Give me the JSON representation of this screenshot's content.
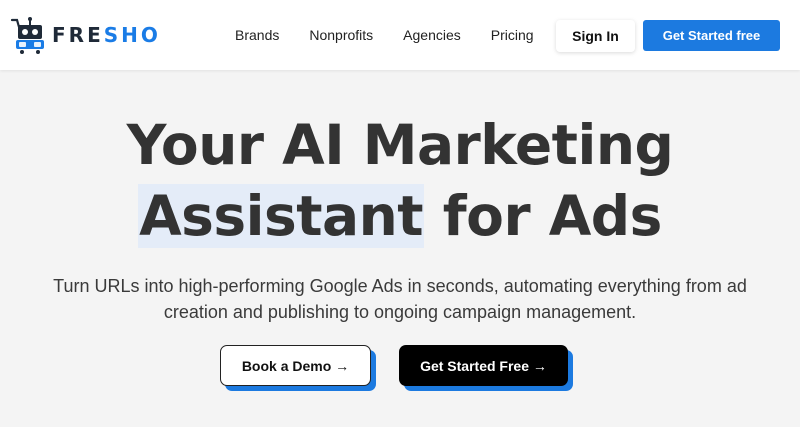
{
  "brand": {
    "name_part1": "FRE",
    "name_part2": "SHO",
    "logo_icon": "robot-cart-icon",
    "accent_color": "#1c7ae0"
  },
  "nav": {
    "links": [
      {
        "label": "Brands"
      },
      {
        "label": "Nonprofits"
      },
      {
        "label": "Agencies"
      },
      {
        "label": "Pricing"
      }
    ],
    "signin_label": "Sign In",
    "cta_label": "Get Started free"
  },
  "hero": {
    "title_line1": "Your AI Marketing",
    "title_highlight": "Assistant",
    "title_line2_rest": " for Ads",
    "subtitle": "Turn URLs into high-performing Google Ads in seconds, automating everything from ad creation and publishing to ongoing campaign management.",
    "demo_label": "Book a Demo →",
    "start_label": "Get Started Free →"
  }
}
